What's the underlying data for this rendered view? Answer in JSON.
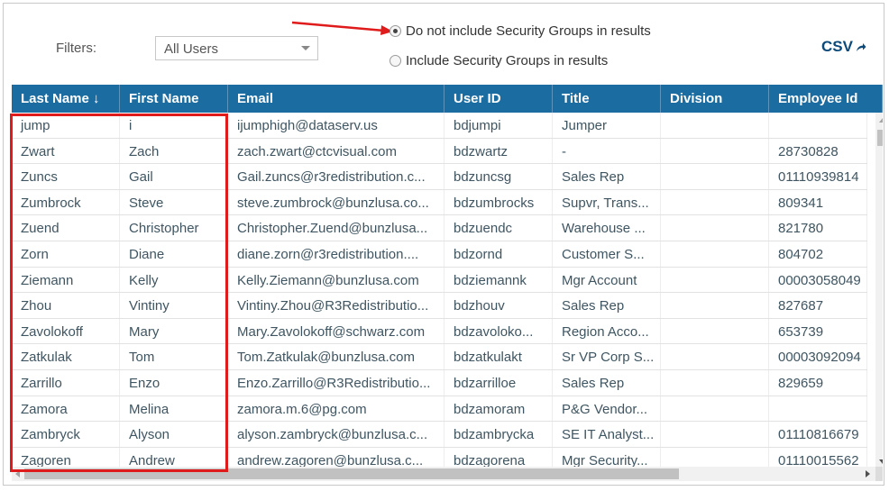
{
  "filters": {
    "label": "Filters:",
    "selected": "All Users"
  },
  "options": {
    "exclude_label": "Do not include Security Groups in results",
    "include_label": "Include Security Groups in results",
    "selected": "exclude"
  },
  "export": {
    "label": "CSV"
  },
  "colors": {
    "header_bg": "#1b6ca1",
    "annotation": "#e01b1b",
    "csv_text": "#0b4a7a"
  },
  "columns": [
    "Last Name",
    "First Name",
    "Email",
    "User ID",
    "Title",
    "Division",
    "Employee Id"
  ],
  "sort_indicator": "↓",
  "rows": [
    [
      "jump",
      "i",
      "ijumphigh@dataserv.us",
      "bdjumpi",
      "Jumper",
      "",
      ""
    ],
    [
      "Zwart",
      "Zach",
      "zach.zwart@ctcvisual.com",
      "bdzwartz",
      "-",
      "",
      "28730828"
    ],
    [
      "Zuncs",
      "Gail",
      "Gail.zuncs@r3redistribution.c...",
      "bdzuncsg",
      "Sales Rep",
      "",
      "01110939814"
    ],
    [
      "Zumbrock",
      "Steve",
      "steve.zumbrock@bunzlusa.co...",
      "bdzumbrocks",
      "Supvr, Trans...",
      "",
      "809341"
    ],
    [
      "Zuend",
      "Christopher",
      "Christopher.Zuend@bunzlusa...",
      "bdzuendc",
      "Warehouse ...",
      "",
      "821780"
    ],
    [
      "Zorn",
      "Diane",
      "diane.zorn@r3redistribution....",
      "bdzornd",
      "Customer S...",
      "",
      "804702"
    ],
    [
      "Ziemann",
      "Kelly",
      "Kelly.Ziemann@bunzlusa.com",
      "bdziemannk",
      "Mgr Account",
      "",
      "00003058049"
    ],
    [
      "Zhou",
      "Vintiny",
      "Vintiny.Zhou@R3Redistributio...",
      "bdzhouv",
      "Sales Rep",
      "",
      "827687"
    ],
    [
      "Zavolokoff",
      "Mary",
      "Mary.Zavolokoff@schwarz.com",
      "bdzavoloko...",
      "Region Acco...",
      "",
      "653739"
    ],
    [
      "Zatkulak",
      "Tom",
      "Tom.Zatkulak@bunzlusa.com",
      "bdzatkulakt",
      "Sr VP Corp S...",
      "",
      "00003092094"
    ],
    [
      "Zarrillo",
      "Enzo",
      "Enzo.Zarrillo@R3Redistributio...",
      "bdzarrilloe",
      "Sales Rep",
      "",
      "829659"
    ],
    [
      "Zamora",
      "Melina",
      "zamora.m.6@pg.com",
      "bdzamoram",
      "P&G Vendor...",
      "",
      ""
    ],
    [
      "Zambryck",
      "Alyson",
      "alyson.zambryck@bunzlusa.c...",
      "bdzambrycka",
      "SE IT Analyst...",
      "",
      "01110816679"
    ],
    [
      "Zagoren",
      "Andrew",
      "andrew.zagoren@bunzlusa.c...",
      "bdzagorena",
      "Mgr Security...",
      "",
      "01110015562"
    ]
  ]
}
